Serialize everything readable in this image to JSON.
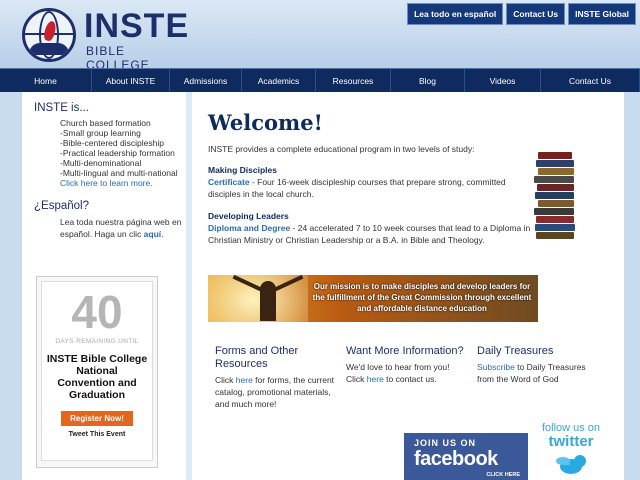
{
  "header": {
    "logo_name": "INSTE",
    "logo_sub": "BIBLE COLLEGE",
    "top_links": [
      "Lea todo en español",
      "Contact Us",
      "INSTE Global"
    ]
  },
  "nav": {
    "items": [
      "Home",
      "About INSTE",
      "Admissions",
      "Academics",
      "Resources",
      "Blog",
      "Videos",
      "Contact Us"
    ]
  },
  "sidebar": {
    "inste_heading": "INSTE is...",
    "inste_items": [
      "Church based formation",
      "-Small group learning",
      "-Bible-centered discipleship",
      "-Practical leadership formation",
      "-Multi-denominational",
      "-Multi-lingual and multi-national"
    ],
    "learn_more": "Click here to learn more.",
    "espanol_heading": "¿Español?",
    "espanol_text": "Lea toda nuestra página web en español. Haga un clic",
    "espanol_link": "aquí",
    "espanol_end": "."
  },
  "countdown": {
    "number": "40",
    "days_label": "DAYS·REMAINING·UNTIL",
    "title": "INSTE Bible College National Convention and Graduation",
    "register": "Register Now!",
    "tweet": "Tweet This Event"
  },
  "main": {
    "welcome": "Welcome!",
    "intro": "INSTE provides a complete educational program in two levels of study:",
    "making_heading": "Making Disciples",
    "making_link": "Certificate",
    "making_text": " - Four 16-week discipleship courses that prepare strong, committed disciples in the local church.",
    "leaders_heading": "Developing Leaders",
    "leaders_link": "Diploma and Degree",
    "leaders_text": " - 24 accelerated 7 to 10 week courses that lead to a Diploma in Christian Ministry or Christian Leadership or a B.A. in Bible and Theology.",
    "banner_text": "Our mission is to make disciples and develop leaders for the fulfillment of the Great Commission through excellent and affordable distance education",
    "col1_heading": "Forms and Other Resources",
    "col1_pre": "Click ",
    "col1_link": "here",
    "col1_post": " for forms, the current catalog, promotional materials, and much more!",
    "col2_heading": "Want More Information?",
    "col2_line1": "We'd love to hear from you!",
    "col2_pre": "Click ",
    "col2_link": "here",
    "col2_post": " to contact us.",
    "col3_heading": "Daily Treasures",
    "col3_link": "Subscribe",
    "col3_post": " to Daily Treasures from the Word of God"
  },
  "social": {
    "fb_join": "JOIN US ON",
    "fb_name": "facebook",
    "fb_click": "CLICK HERE",
    "tw_follow": "follow us on",
    "tw_name": "twitter"
  },
  "colors": {
    "navy": "#0e2a5e",
    "link_blue": "#2a6bb8",
    "orange": "#e5651b",
    "facebook": "#3b5998",
    "twitter": "#3aa6d8"
  }
}
